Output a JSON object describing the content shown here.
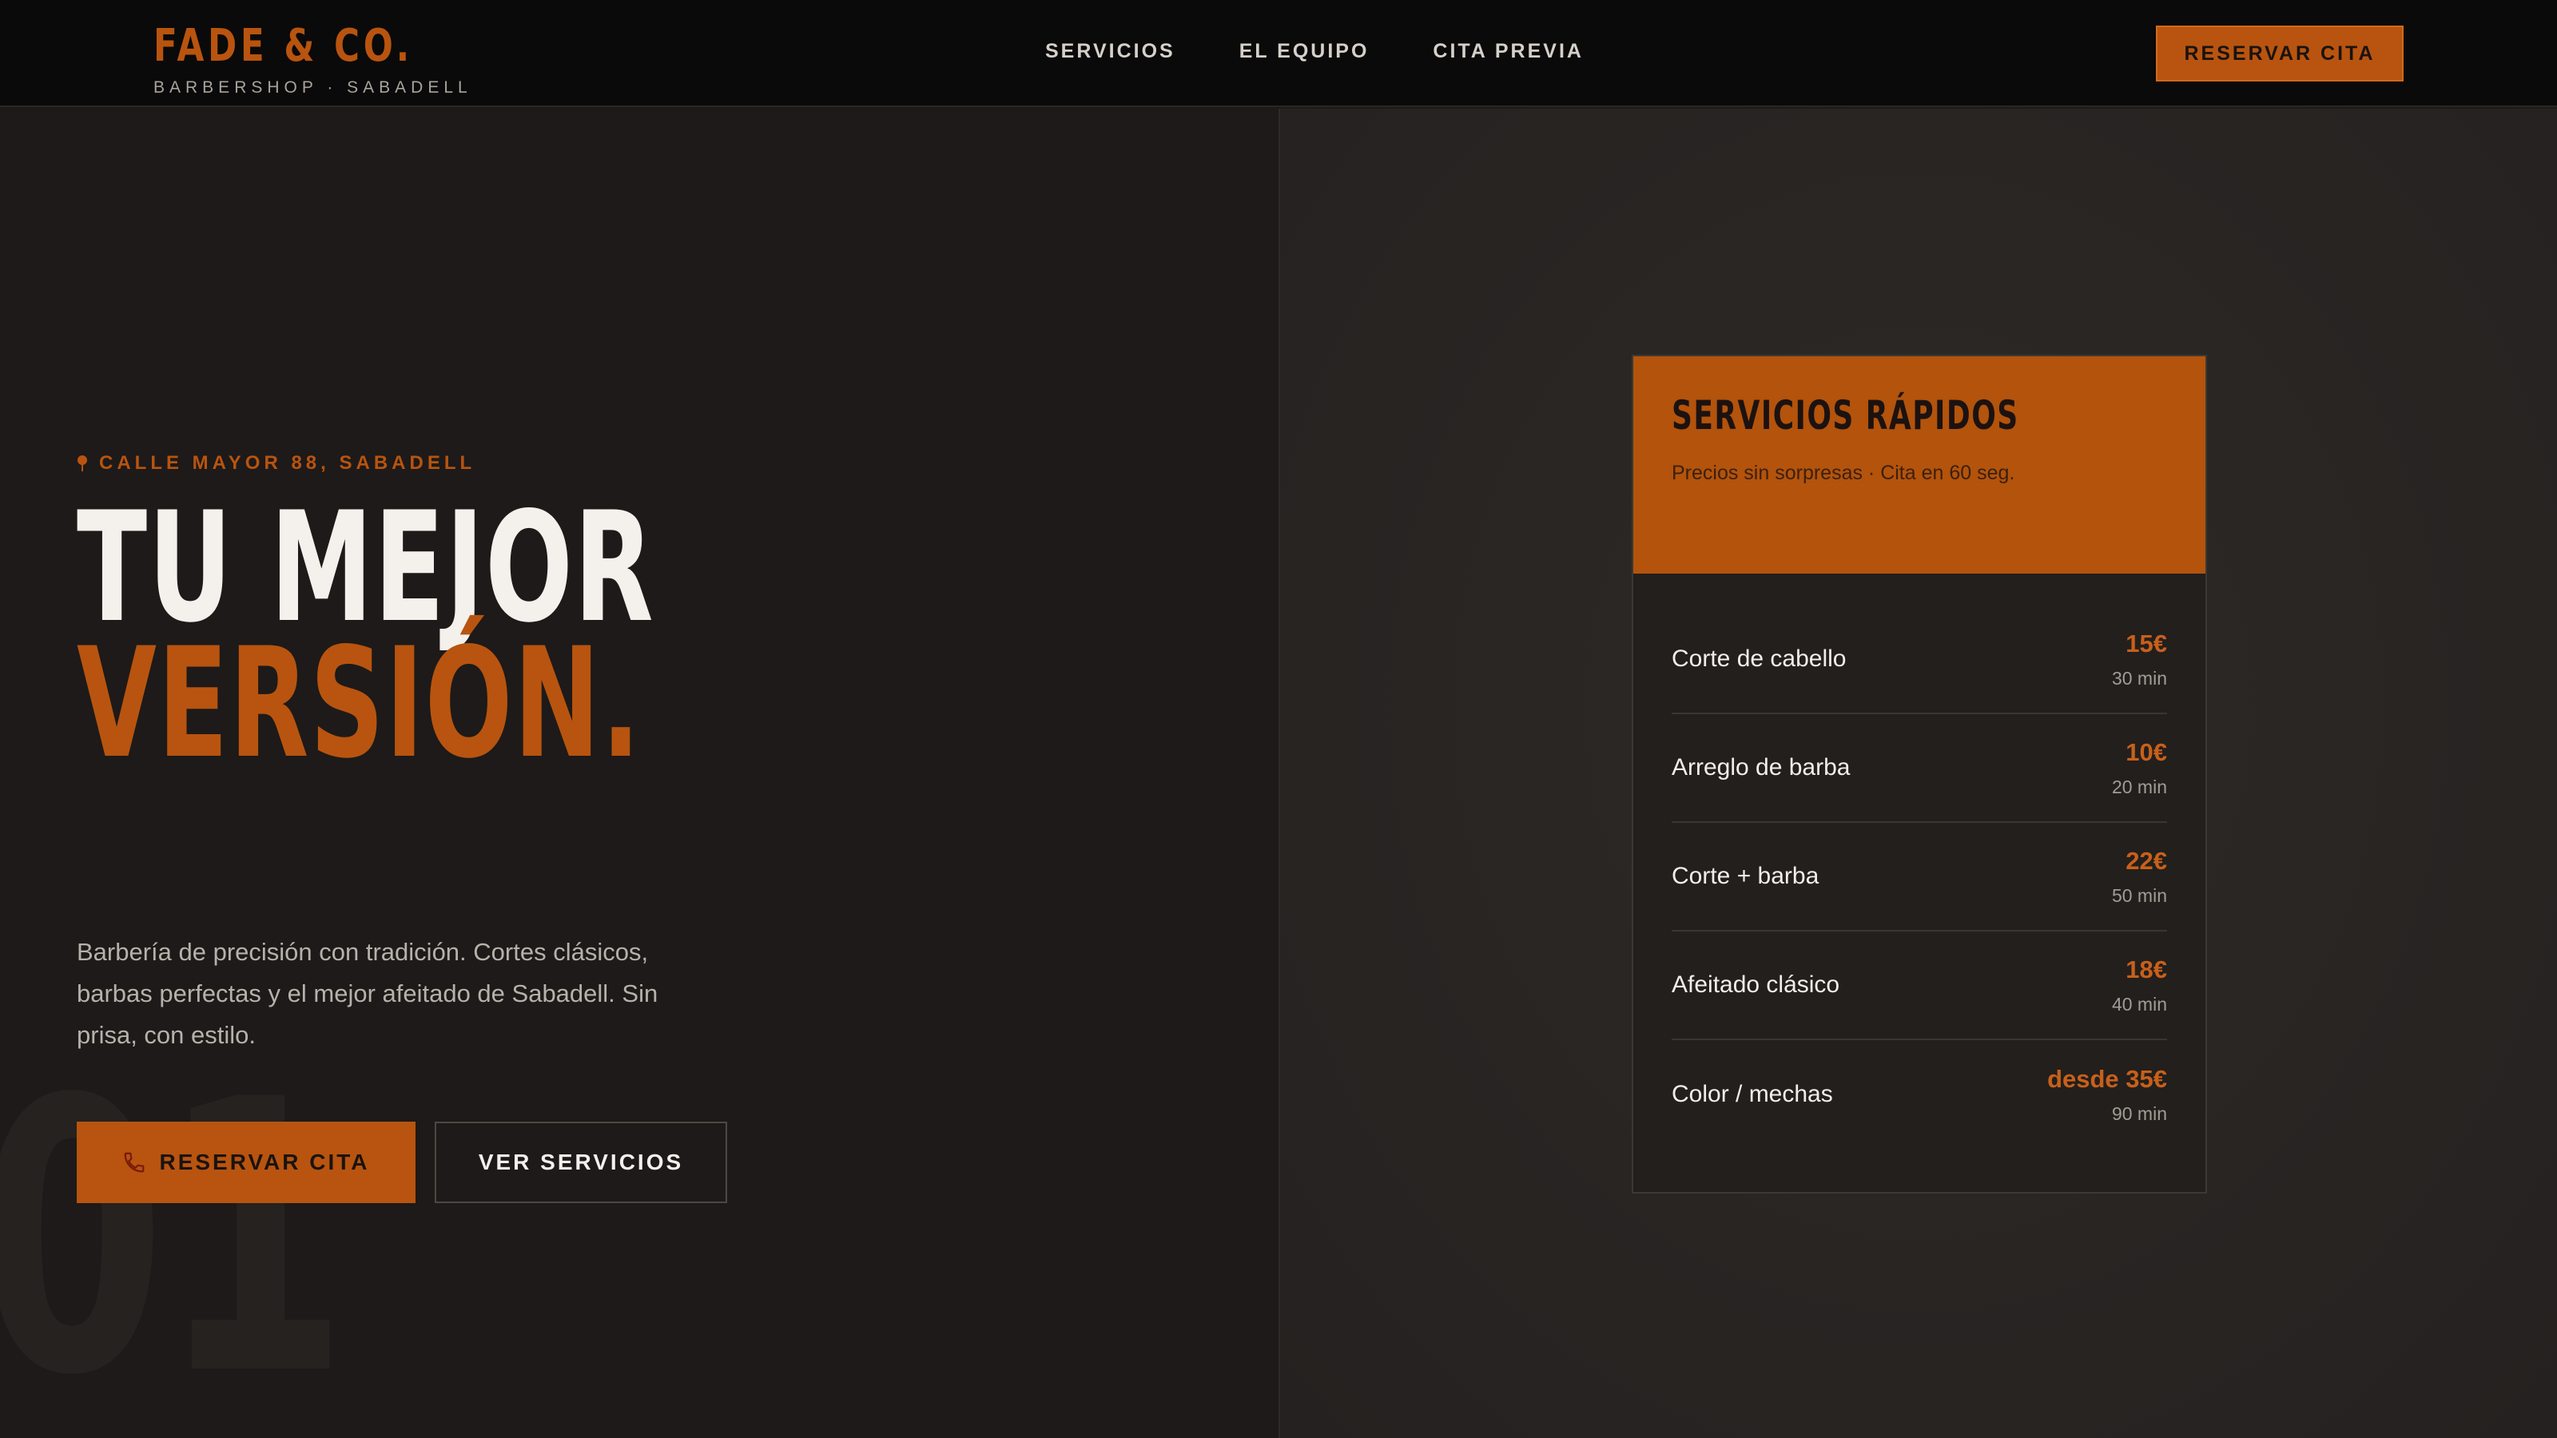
{
  "nav": {
    "brand": "FADE & CO.",
    "brand_sub": "BARBERSHOP · SABADELL",
    "links": [
      "SERVICIOS",
      "EL EQUIPO",
      "CITA PREVIA"
    ],
    "cta": "RESERVAR CITA"
  },
  "hero": {
    "location": "CALLE MAYOR 88, SABADELL",
    "headline_1": "TU MEJOR",
    "headline_2": "VERSIÓN.",
    "description": "Barbería de precisión con tradición. Cortes clásicos, barbas perfectas y el mejor afeitado de Sabadell. Sin prisa, con estilo.",
    "primary_button": "RESERVAR CITA",
    "secondary_button": "VER SERVICIOS",
    "background_number": "01"
  },
  "card": {
    "title": "SERVICIOS RÁPIDOS",
    "subtitle": "Precios sin sorpresas · Cita en 60 seg.",
    "services": [
      {
        "name": "Corte de cabello",
        "price": "15€",
        "duration": "30 min"
      },
      {
        "name": "Arreglo de barba",
        "price": "10€",
        "duration": "20 min"
      },
      {
        "name": "Corte + barba",
        "price": "22€",
        "duration": "50 min"
      },
      {
        "name": "Afeitado clásico",
        "price": "18€",
        "duration": "40 min"
      },
      {
        "name": "Color / mechas",
        "price": "desde 35€",
        "duration": "90 min"
      }
    ]
  },
  "icons": {
    "location": "map-pin-icon",
    "phone": "phone-icon"
  },
  "colors": {
    "accent": "#b8540f",
    "background": "#1d1a19",
    "nav": "#0a0a0a"
  }
}
